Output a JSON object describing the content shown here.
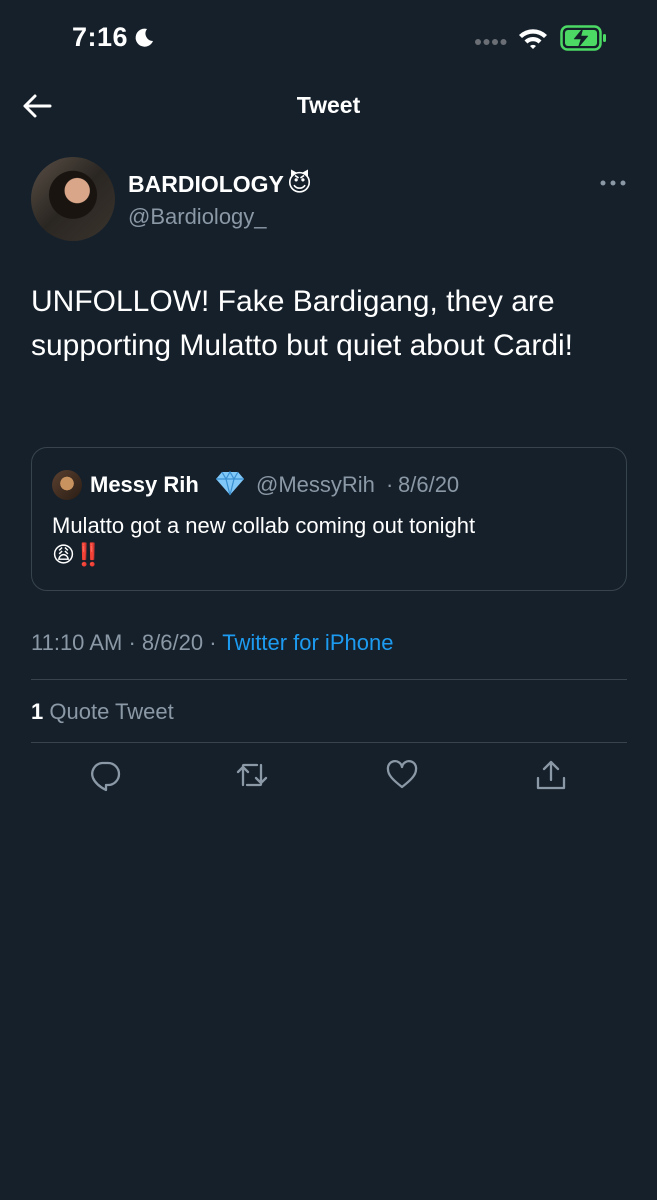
{
  "status": {
    "time": "7:16"
  },
  "nav": {
    "title": "Tweet"
  },
  "tweet": {
    "author_name": "BARDIOLOGY",
    "author_emoji": "😈",
    "author_handle": "@Bardiology_",
    "text": "UNFOLLOW! Fake Bardigang, they are supporting Mulatto but quiet about Cardi!",
    "time": "11:10 AM",
    "date": "8/6/20",
    "source": "Twitter for iPhone",
    "quote_count": "1",
    "quote_label": "Quote Tweet"
  },
  "quoted": {
    "name": "Messy Rih",
    "handle": "@MessyRih",
    "date": "8/6/20",
    "text": "Mulatto got a new collab coming out tonight",
    "emojis": "😩‼️"
  },
  "icons": {
    "back": "arrow-left-icon",
    "more": "more-horizontal-icon",
    "reply": "reply-icon",
    "retweet": "retweet-icon",
    "like": "heart-icon",
    "share": "share-icon"
  },
  "colors": {
    "background": "#15202b",
    "link": "#1d9bf0",
    "secondary_text": "#8b98a5",
    "border": "#38444d",
    "battery": "#4cd964"
  }
}
